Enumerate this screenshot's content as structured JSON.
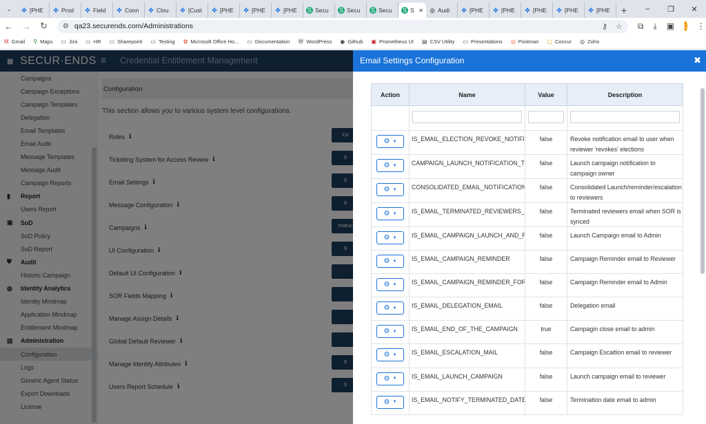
{
  "browser": {
    "tabs": [
      {
        "label": "[PHE",
        "icon": "blue"
      },
      {
        "label": "Prod",
        "icon": "blue"
      },
      {
        "label": "Field",
        "icon": "blue"
      },
      {
        "label": "Conn",
        "icon": "blue"
      },
      {
        "label": "Clou",
        "icon": "blue"
      },
      {
        "label": "[Cust",
        "icon": "blue"
      },
      {
        "label": "[PHE",
        "icon": "blue"
      },
      {
        "label": "[PHE",
        "icon": "blue"
      },
      {
        "label": "[PHE",
        "icon": "blue"
      },
      {
        "label": "Secu",
        "icon": "green"
      },
      {
        "label": "Secu",
        "icon": "green"
      },
      {
        "label": "Secu",
        "icon": "green"
      },
      {
        "label": "S",
        "icon": "green",
        "active": true
      },
      {
        "label": "Audi",
        "icon": "globe"
      },
      {
        "label": "[PHE",
        "icon": "blue"
      },
      {
        "label": "[PHE",
        "icon": "blue"
      },
      {
        "label": "[PHE",
        "icon": "blue"
      },
      {
        "label": "[PHE",
        "icon": "blue"
      },
      {
        "label": "[PHE",
        "icon": "blue"
      }
    ],
    "url": "qa23.securends.com/Administrations",
    "profile_initial": "L",
    "bookmarks": [
      "Gmail",
      "Maps",
      "Jira",
      "HR",
      "Sharepoint",
      "Testing",
      "Microsoft Office Ho...",
      "Documentation",
      "WordPress",
      "Github",
      "Prometheus UI",
      "CSV Utility",
      "Presentations",
      "Postman",
      "Concur",
      "Zoho"
    ]
  },
  "app": {
    "logo": "SECUR·ENDS",
    "title": "Credential Entitlement Management",
    "sidebar": [
      {
        "type": "item",
        "label": "Campaigns"
      },
      {
        "type": "item",
        "label": "Campaign Exceptions"
      },
      {
        "type": "item",
        "label": "Campaign Templates"
      },
      {
        "type": "item",
        "label": "Delegation"
      },
      {
        "type": "item",
        "label": "Email Templates"
      },
      {
        "type": "item",
        "label": "Email Audit"
      },
      {
        "type": "item",
        "label": "Message Templates"
      },
      {
        "type": "item",
        "label": "Message Audit"
      },
      {
        "type": "item",
        "label": "Campaign Reports"
      },
      {
        "type": "head",
        "label": "Report",
        "icon": "report-icon"
      },
      {
        "type": "item",
        "label": "Users Report"
      },
      {
        "type": "head",
        "label": "SoD",
        "icon": "sod-icon"
      },
      {
        "type": "item",
        "label": "SoD Policy"
      },
      {
        "type": "item",
        "label": "SoD Report"
      },
      {
        "type": "head",
        "label": "Audit",
        "icon": "shield-icon"
      },
      {
        "type": "item",
        "label": "Historic Campaign"
      },
      {
        "type": "head",
        "label": "Identity Analytics",
        "icon": "analytics-icon"
      },
      {
        "type": "item",
        "label": "Identity Mindmap"
      },
      {
        "type": "item",
        "label": "Application Mindmap"
      },
      {
        "type": "item",
        "label": "Entitlement Mindmap"
      },
      {
        "type": "head",
        "label": "Administration",
        "icon": "admin-icon"
      },
      {
        "type": "item",
        "label": "Configuration",
        "active": true
      },
      {
        "type": "item",
        "label": "Logs"
      },
      {
        "type": "item",
        "label": "Generic Agent Status"
      },
      {
        "type": "item",
        "label": "Export Downloads"
      },
      {
        "type": "item",
        "label": "License"
      }
    ],
    "config_header": "Configuration",
    "section_desc": "This section allows you to various system level configurations.",
    "config_rows": [
      {
        "label": "Roles",
        "btn": "Co"
      },
      {
        "label": "Ticketing System for Access Review",
        "btn": "S"
      },
      {
        "label": "Email Settings",
        "btn": "S"
      },
      {
        "label": "Message Configuration",
        "btn": "S"
      },
      {
        "label": "Campaigns",
        "btn": "Instruc"
      },
      {
        "label": "UI Configuration",
        "btn": "S"
      },
      {
        "label": "Default UI Configuration",
        "btn": ""
      },
      {
        "label": "SOR Fields Mapping",
        "btn": ""
      },
      {
        "label": "Manage Assign Details",
        "btn": ""
      },
      {
        "label": "Global Default Reviewer",
        "btn": ""
      },
      {
        "label": "Manage Identity Attributes",
        "btn": "S"
      },
      {
        "label": "Users Report Schedule",
        "btn": "S"
      }
    ]
  },
  "modal": {
    "title": "Email Settings Configuration",
    "columns": [
      "Action",
      "Name",
      "Value",
      "Description"
    ],
    "rows": [
      {
        "name": "IS_EMAIL_ELECTION_REVOKE_NOTIFICATION",
        "value": "false",
        "desc": "Revoke notification email to user when reviewer 'revokes' elections"
      },
      {
        "name": "CAMPAIGN_LAUNCH_NOTIFICATION_TO_CAMPAIGN_OWNER",
        "value": "false",
        "desc": "Launch campaign notification to campaign owner"
      },
      {
        "name": "CONSOLIDATED_EMAIL_NOTIFICATION_UA",
        "value": "false",
        "desc": "Consolidated Launch/reminder/escalation to reviewers"
      },
      {
        "name": "IS_EMAIL_TERMINATED_REVIEWERS_NOTIFICATION",
        "value": "false",
        "desc": "Terminated reviewers email when SOR is synced"
      },
      {
        "name": "IS_EMAIL_CAMPAIGN_LAUNCH_AND_RELAUNCH",
        "value": "false",
        "desc": "Launch Campaign email to Admin"
      },
      {
        "name": "IS_EMAIL_CAMPAIGN_REMINDER",
        "value": "false",
        "desc": "Campaign Reminder email to Reviewer"
      },
      {
        "name": "IS_EMAIL_CAMPAIGN_REMINDER_FOR_IT_TEAM",
        "value": "false",
        "desc": "Campaign Reminder email to Admin"
      },
      {
        "name": "IS_EMAIL_DELEGATION_EMAIL",
        "value": "false",
        "desc": "Delegation email"
      },
      {
        "name": "IS_EMAIL_END_OF_THE_CAMPAIGN",
        "value": "true",
        "desc": "Campagin close email to admin"
      },
      {
        "name": "IS_EMAIL_ESCALATION_MAIL",
        "value": "false",
        "desc": "Campaign Escaltion email to reviewer"
      },
      {
        "name": "IS_EMAIL_LAUNCH_CAMPAIGN",
        "value": "false",
        "desc": "Launch campaign email to reviewer"
      },
      {
        "name": "IS_EMAIL_NOTIFY_TERMINATED_DATE",
        "value": "false",
        "desc": "Termination date email to admin"
      }
    ]
  }
}
